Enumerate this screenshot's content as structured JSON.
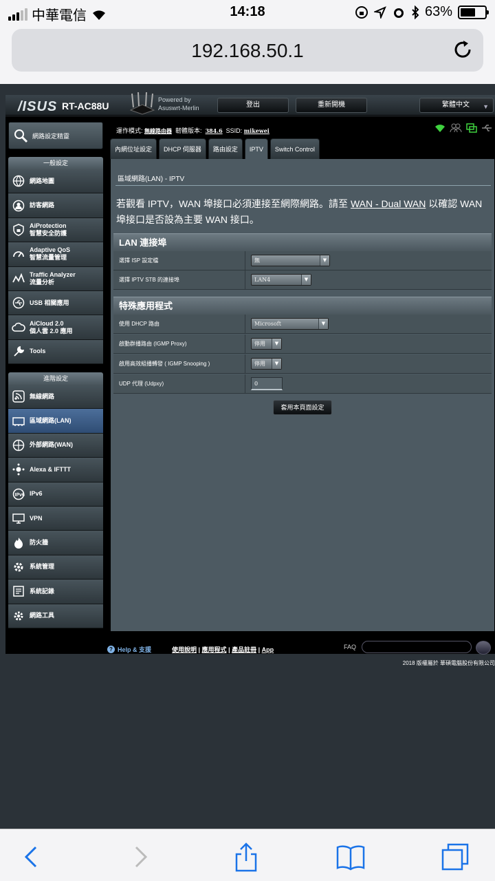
{
  "status_bar": {
    "carrier": "中華電信",
    "time": "14:18",
    "battery": "63%",
    "battery_level": 0.63
  },
  "browser": {
    "url": "192.168.50.1"
  },
  "router": {
    "brand": "/ISUS",
    "model": "RT-AC88U",
    "powered_by_1": "Powered by",
    "powered_by_2": "Asuswrt-Merlin",
    "logout_label": "登出",
    "reboot_label": "重新開機",
    "language": "繁體中文"
  },
  "info": {
    "mode_label": "運作模式:",
    "mode_value": "無線路由器",
    "fw_label": "韌體版本:",
    "fw_value": "384.6",
    "ssid_label": "SSID:",
    "ssid_value": "mikewei"
  },
  "sidebar": {
    "qis_label": "網路設定精靈",
    "general_header": "一般設定",
    "general_items": [
      {
        "icon": "globe-map-icon",
        "label": "網路地圖",
        "label2": ""
      },
      {
        "icon": "guest-network-icon",
        "label": "訪客網路",
        "label2": ""
      },
      {
        "icon": "shield-lock-icon",
        "label": "AiProtection",
        "label2": "智慧安全防護"
      },
      {
        "icon": "speedometer-icon",
        "label": "Adaptive QoS",
        "label2": "智慧流量管理"
      },
      {
        "icon": "traffic-graph-icon",
        "label": "Traffic Analyzer",
        "label2": "流量分析"
      },
      {
        "icon": "usb-icon",
        "label": "USB 相關應用",
        "label2": ""
      },
      {
        "icon": "cloud-icon",
        "label": "AiCloud 2.0",
        "label2": "個人雲 2.0 應用"
      },
      {
        "icon": "wrench-icon",
        "label": "Tools",
        "label2": ""
      }
    ],
    "advanced_header": "進階設定",
    "advanced_items": [
      {
        "icon": "wireless-icon",
        "label": "無線網路"
      },
      {
        "icon": "lan-icon",
        "label": "區域網路(LAN)"
      },
      {
        "icon": "wan-globe-icon",
        "label": "外部網路(WAN)"
      },
      {
        "icon": "alexa-ifttt-icon",
        "label": "Alexa & IFTTT"
      },
      {
        "icon": "ipv6-icon",
        "label": "IPv6"
      },
      {
        "icon": "vpn-icon",
        "label": "VPN"
      },
      {
        "icon": "firewall-icon",
        "label": "防火牆"
      },
      {
        "icon": "admin-gear-icon",
        "label": "系統管理"
      },
      {
        "icon": "system-log-icon",
        "label": "系統記錄"
      },
      {
        "icon": "network-tools-icon",
        "label": "網路工具"
      }
    ]
  },
  "tabs": [
    {
      "label": "內網位址設定"
    },
    {
      "label": "DHCP 伺服器"
    },
    {
      "label": "路由設定"
    },
    {
      "label": "IPTV"
    },
    {
      "label": "Switch Control"
    }
  ],
  "panel": {
    "title": "區域網路(LAN) - IPTV",
    "desc_1": "若觀看 IPTV，WAN 埠接口必須連接至網際網路。請至 ",
    "desc_link": "WAN - Dual WAN",
    "desc_2": " 以確認 WAN 埠接口是否設為主要 WAN 接口。",
    "lan_header": "LAN 連接埠",
    "isp_label": "選擇 ISP 設定檔",
    "isp_value": "無",
    "stb_label": "選擇 IPTV STB 的連接埠",
    "stb_value": "LAN4",
    "special_header": "特殊應用程式",
    "dhcp_route_label": "使用 DHCP 路由",
    "dhcp_route_value": "Microsoft",
    "igmp_proxy_label": "啟動群播路由 (IGMP Proxy)",
    "igmp_proxy_value": "停用",
    "igmp_snoop_label": "啟用高效組播轉發 ( IGMP Snooping )",
    "igmp_snoop_value": "停用",
    "udpxy_label": "UDP 代理 (Udpxy)",
    "udpxy_value": "0",
    "apply_label": "套用本頁面設定"
  },
  "footer": {
    "help": "Help & 支援",
    "link1": "使用說明",
    "link2": "應用程式",
    "link3": "產品註冊",
    "link4": "App",
    "faq": "FAQ",
    "copyright": "2018 版權屬於 華碩電腦股份有限公司"
  }
}
